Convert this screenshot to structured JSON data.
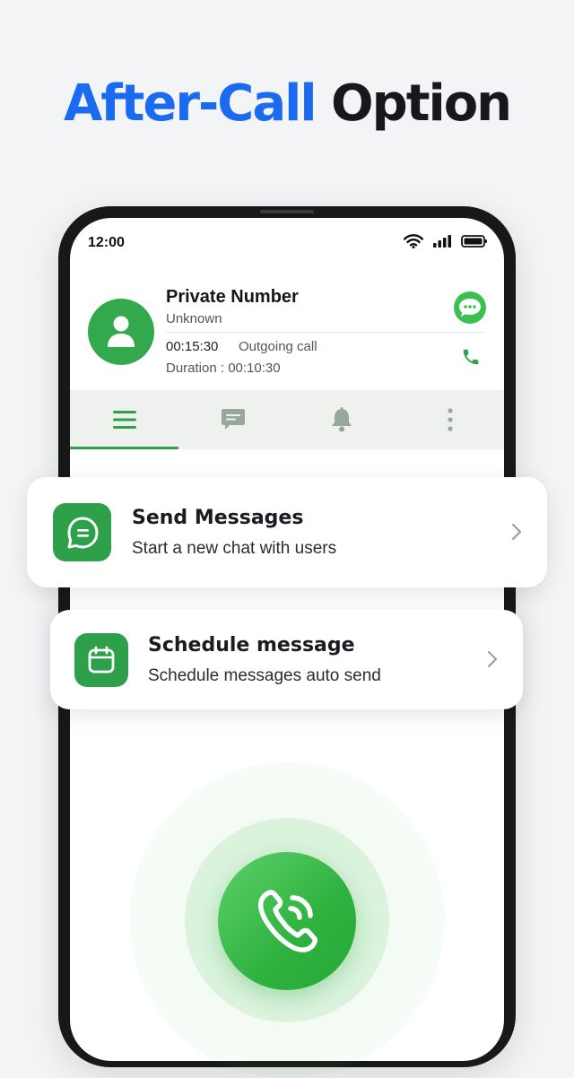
{
  "headline": {
    "accent": "After-Call",
    "dark": "Option"
  },
  "status_bar": {
    "time": "12:00",
    "icons": [
      "wifi-icon",
      "signal-icon",
      "battery-icon"
    ]
  },
  "caller": {
    "name": "Private Number",
    "subtitle": "Unknown",
    "call_time": "00:15:30",
    "call_type": "Outgoing call",
    "duration": "Duration : 00:10:30"
  },
  "tabs": [
    {
      "icon": "menu-icon",
      "active": true
    },
    {
      "icon": "message-icon",
      "active": false
    },
    {
      "icon": "bell-icon",
      "active": false
    },
    {
      "icon": "more-vertical-icon",
      "active": false
    }
  ],
  "cards": [
    {
      "title": "Send Messages",
      "subtitle": "Start a new chat with users",
      "icon": "chat-bubble-icon"
    },
    {
      "title": "Schedule message",
      "subtitle": "Schedule messages auto send",
      "icon": "calendar-icon"
    }
  ],
  "colors": {
    "accent_blue": "#1a6bf0",
    "brand_green": "#2fa04a",
    "bright_green": "#3cc04f",
    "background": "#f3f4f6"
  }
}
